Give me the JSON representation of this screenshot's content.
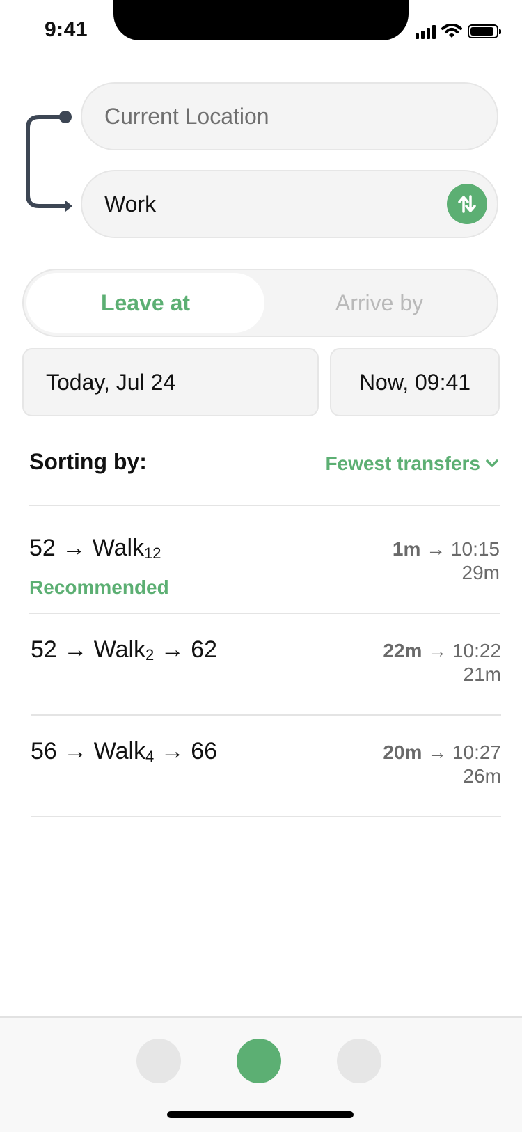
{
  "status_bar": {
    "time": "9:41"
  },
  "route_inputs": {
    "origin_placeholder": "Current Location",
    "destination_value": "Work"
  },
  "mode": {
    "active": "Leave at",
    "inactive": "Arrive by"
  },
  "date": "Today, Jul 24",
  "time": "Now, 09:41",
  "sorting": {
    "label": "Sorting by:",
    "value": "Fewest transfers"
  },
  "routes": [
    {
      "legs": [
        "52",
        "Walk",
        "12",
        ""
      ],
      "tag": "Recommended",
      "wait": "1m",
      "arrival": "10:15",
      "duration": "29m"
    },
    {
      "legs": [
        "52",
        "Walk",
        "2",
        "62"
      ],
      "tag": "",
      "wait": "22m",
      "arrival": "10:22",
      "duration": "21m"
    },
    {
      "legs": [
        "56",
        "Walk",
        "4",
        "66"
      ],
      "tag": "",
      "wait": "20m",
      "arrival": "10:27",
      "duration": "26m"
    }
  ],
  "colors": {
    "accent": "#5caf73",
    "muted": "#6a6a6a",
    "field_bg": "#f4f4f4"
  },
  "tabs": [
    "tab-1",
    "tab-2",
    "tab-3"
  ]
}
